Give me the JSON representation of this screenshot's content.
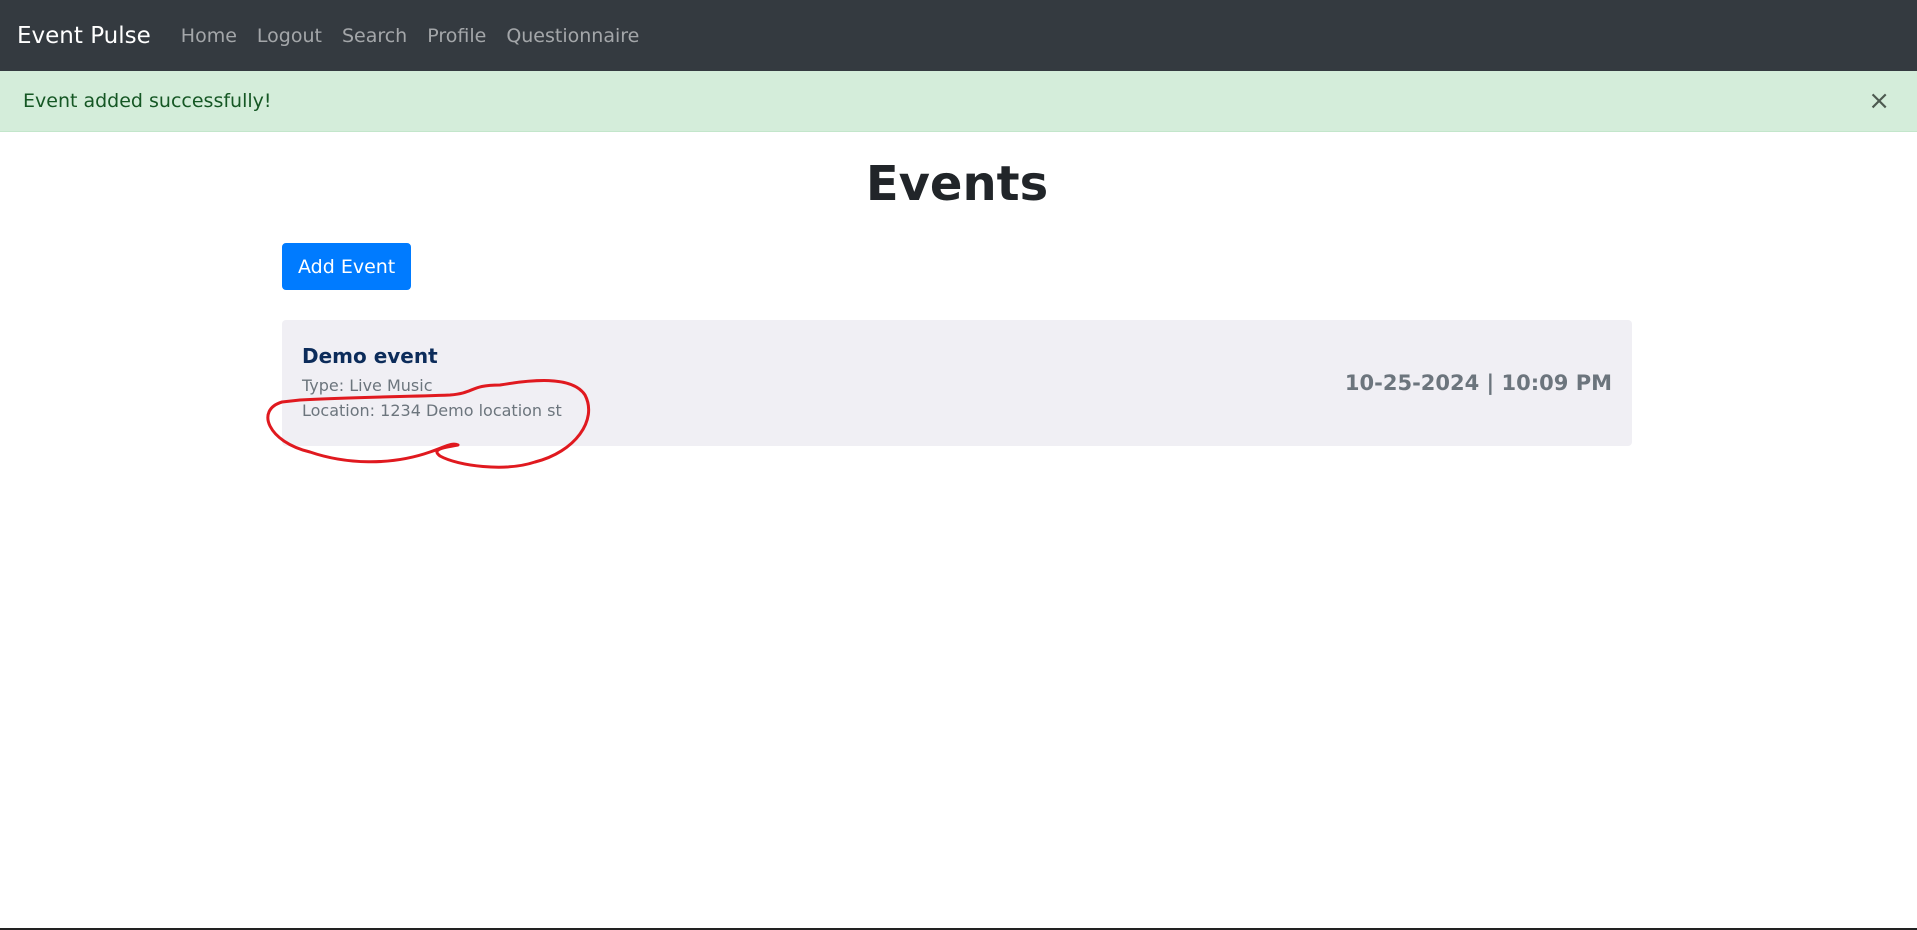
{
  "navbar": {
    "brand": "Event Pulse",
    "links": [
      "Home",
      "Logout",
      "Search",
      "Profile",
      "Questionnaire"
    ]
  },
  "alert": {
    "message": "Event added successfully!",
    "close_symbol": "×"
  },
  "main": {
    "title": "Events",
    "add_button_label": "Add Event",
    "events": [
      {
        "name": "Demo event",
        "type": "Type: Live Music",
        "location": "Location: 1234 Demo location st",
        "datetime": "10-25-2024 | 10:09 PM"
      }
    ]
  },
  "colors": {
    "navbar_bg": "#343a40",
    "alert_bg": "#d4edda",
    "alert_text": "#155724",
    "primary": "#007bff",
    "card_bg": "#f0eff4",
    "annotation": "#e0191f"
  }
}
